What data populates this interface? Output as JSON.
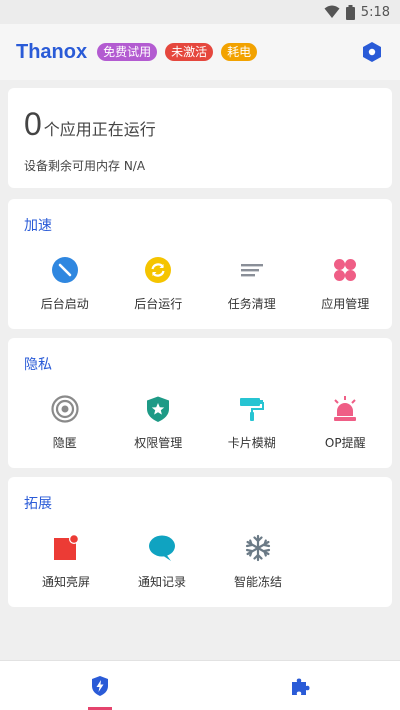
{
  "status_bar": {
    "time": "5:18"
  },
  "app": {
    "title": "Thanox",
    "badges": [
      {
        "label": "免费试用",
        "color": "#b35bd1"
      },
      {
        "label": "未激活",
        "color": "#e5473d"
      },
      {
        "label": "耗电",
        "color": "#f2a200"
      }
    ],
    "settings_icon": "hexagon-settings-icon",
    "accent": "#2a5bd7"
  },
  "status_card": {
    "running_count": "0",
    "running_text": "个应用正在运行",
    "memory_text": "设备剩余可用内存 N/A"
  },
  "sections": [
    {
      "title": "加速",
      "items": [
        {
          "label": "后台启动",
          "icon": "block-start-icon"
        },
        {
          "label": "后台运行",
          "icon": "sync-icon"
        },
        {
          "label": "任务清理",
          "icon": "clear-list-icon"
        },
        {
          "label": "应用管理",
          "icon": "apps-grid-icon"
        }
      ]
    },
    {
      "title": "隐私",
      "items": [
        {
          "label": "隐匿",
          "icon": "target-icon"
        },
        {
          "label": "权限管理",
          "icon": "shield-star-icon"
        },
        {
          "label": "卡片模糊",
          "icon": "paint-roller-icon"
        },
        {
          "label": "OP提醒",
          "icon": "alarm-light-icon"
        }
      ]
    },
    {
      "title": "拓展",
      "items": [
        {
          "label": "通知亮屏",
          "icon": "notification-screen-icon"
        },
        {
          "label": "通知记录",
          "icon": "chat-bubble-icon"
        },
        {
          "label": "智能冻结",
          "icon": "snowflake-icon"
        }
      ]
    }
  ],
  "bottom_nav": {
    "items": [
      {
        "icon": "shield-bolt-icon",
        "active": true
      },
      {
        "icon": "puzzle-icon",
        "active": false
      }
    ]
  }
}
